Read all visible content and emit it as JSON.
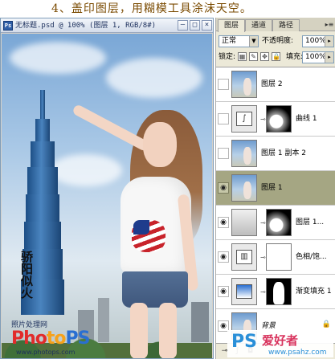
{
  "heading": "4、盖印图层，用糊模工具涂沫天空。",
  "document": {
    "title": "无标题.psd @ 100% (图层 1, RGB/8#)",
    "calligraphy": "骄阳似火",
    "logo_caption": "照片处理网",
    "logo_text": [
      "Pho",
      "to",
      "PS"
    ],
    "logo_url": "www.photops.com"
  },
  "panel": {
    "tabs": [
      "图层",
      "通道",
      "路径"
    ],
    "blend_mode": "正常",
    "opacity_label": "不透明度:",
    "opacity_value": "100%",
    "lock_label": "锁定:",
    "fill_label": "填充:",
    "fill_value": "100%",
    "layers": [
      {
        "name": "图层 2",
        "visible": false,
        "thumb": "photo",
        "mask": null,
        "selected": false
      },
      {
        "name": "曲线 1",
        "visible": false,
        "thumb": "adjustment",
        "mask": "blackmask",
        "selected": false
      },
      {
        "name": "图层 1 副本 2",
        "visible": false,
        "thumb": "photo",
        "mask": null,
        "selected": false
      },
      {
        "name": "图层 1",
        "visible": true,
        "thumb": "photo",
        "mask": null,
        "selected": true
      },
      {
        "name": "图层 1...",
        "visible": true,
        "thumb": "gradient",
        "mask": "blackmask",
        "selected": false
      },
      {
        "name": "色相/饱...",
        "visible": true,
        "thumb": "adjustment",
        "mask": "whitemask",
        "selected": false
      },
      {
        "name": "渐变填充 1",
        "visible": true,
        "thumb": "gradient",
        "mask": "silhouette",
        "selected": false
      },
      {
        "name": "背景",
        "visible": true,
        "thumb": "photo",
        "mask": null,
        "selected": false
      }
    ]
  },
  "watermark": {
    "ps": "PS",
    "cn": "爱好者",
    "url": "www.psahz.com"
  },
  "icons": {
    "visibility": "eye-icon",
    "link": "chain-link-icon",
    "lock": "lock-icon",
    "panel_menu": "panel-menu-icon"
  }
}
